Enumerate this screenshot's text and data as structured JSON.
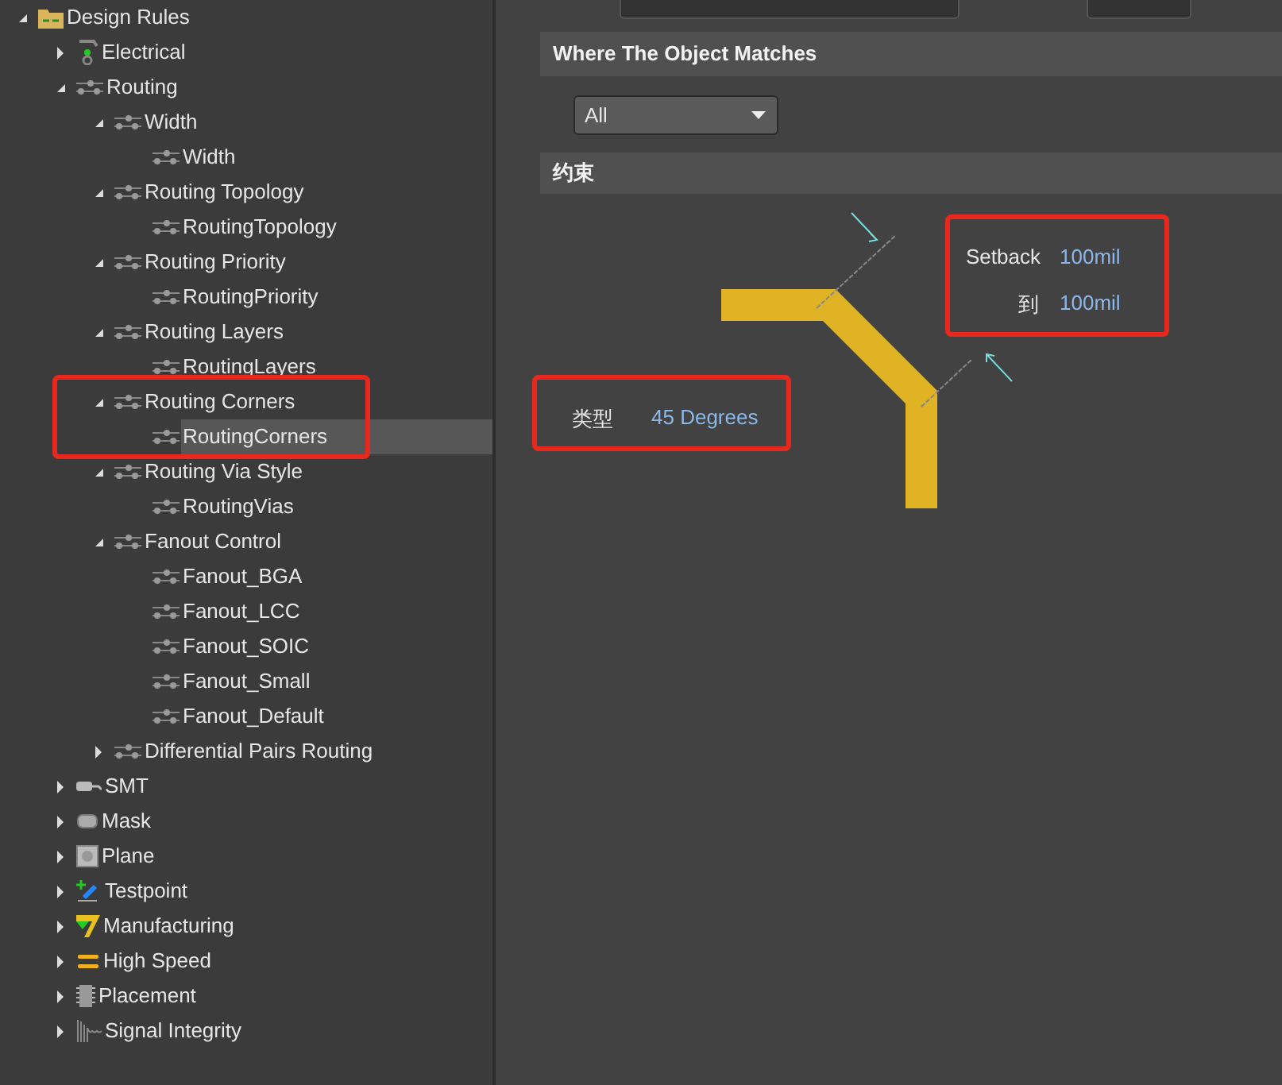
{
  "tree": [
    {
      "label": "Design Rules",
      "kind": "folder",
      "expanded": true,
      "selected": false,
      "children": [
        {
          "label": "Electrical",
          "kind": "electrical",
          "expanded": false,
          "selected": false
        },
        {
          "label": "Routing",
          "kind": "rule",
          "expanded": true,
          "selected": false,
          "children": [
            {
              "label": "Width",
              "kind": "rule",
              "expanded": true,
              "selected": false,
              "children": [
                {
                  "label": "Width",
                  "kind": "rule",
                  "selected": false
                }
              ]
            },
            {
              "label": "Routing Topology",
              "kind": "rule",
              "expanded": true,
              "selected": false,
              "children": [
                {
                  "label": "RoutingTopology",
                  "kind": "rule",
                  "selected": false
                }
              ]
            },
            {
              "label": "Routing Priority",
              "kind": "rule",
              "expanded": true,
              "selected": false,
              "children": [
                {
                  "label": "RoutingPriority",
                  "kind": "rule",
                  "selected": false
                }
              ]
            },
            {
              "label": "Routing Layers",
              "kind": "rule",
              "expanded": true,
              "selected": false,
              "children": [
                {
                  "label": "RoutingLayers",
                  "kind": "rule",
                  "selected": false
                }
              ]
            },
            {
              "label": "Routing Corners",
              "kind": "rule",
              "expanded": true,
              "selected": false,
              "children": [
                {
                  "label": "RoutingCorners",
                  "kind": "rule",
                  "selected": true
                }
              ]
            },
            {
              "label": "Routing Via Style",
              "kind": "rule",
              "expanded": true,
              "selected": false,
              "children": [
                {
                  "label": "RoutingVias",
                  "kind": "rule",
                  "selected": false
                }
              ]
            },
            {
              "label": "Fanout Control",
              "kind": "rule",
              "expanded": true,
              "selected": false,
              "children": [
                {
                  "label": "Fanout_BGA",
                  "kind": "rule",
                  "selected": false
                },
                {
                  "label": "Fanout_LCC",
                  "kind": "rule",
                  "selected": false
                },
                {
                  "label": "Fanout_SOIC",
                  "kind": "rule",
                  "selected": false
                },
                {
                  "label": "Fanout_Small",
                  "kind": "rule",
                  "selected": false
                },
                {
                  "label": "Fanout_Default",
                  "kind": "rule",
                  "selected": false
                }
              ]
            },
            {
              "label": "Differential Pairs Routing",
              "kind": "rule",
              "expanded": false,
              "selected": false
            }
          ]
        },
        {
          "label": "SMT",
          "kind": "smt",
          "expanded": false,
          "selected": false
        },
        {
          "label": "Mask",
          "kind": "mask",
          "expanded": false,
          "selected": false
        },
        {
          "label": "Plane",
          "kind": "plane",
          "expanded": false,
          "selected": false
        },
        {
          "label": "Testpoint",
          "kind": "testpoint",
          "expanded": false,
          "selected": false
        },
        {
          "label": "Manufacturing",
          "kind": "manufacturing",
          "expanded": false,
          "selected": false
        },
        {
          "label": "High Speed",
          "kind": "highspeed",
          "expanded": false,
          "selected": false
        },
        {
          "label": "Placement",
          "kind": "placement",
          "expanded": false,
          "selected": false
        },
        {
          "label": "Signal Integrity",
          "kind": "signal",
          "expanded": false,
          "selected": false
        }
      ]
    }
  ],
  "match_section": {
    "title": "Where The Object Matches",
    "dropdown": {
      "value": "All"
    }
  },
  "constraints_section": {
    "title": "约束"
  },
  "corner": {
    "setback_label": "Setback",
    "setback_value": "100mil",
    "to_label": "到",
    "to_value": "100mil",
    "type_label": "类型",
    "type_value": "45 Degrees"
  }
}
